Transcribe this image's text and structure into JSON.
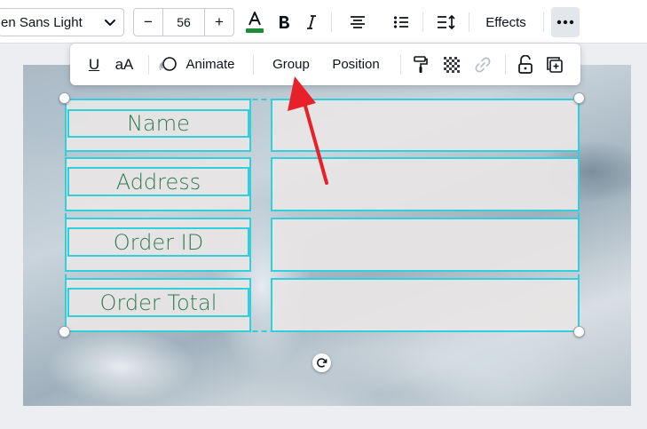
{
  "toolbar": {
    "font_name": "en Sans Light",
    "font_size": "56",
    "decrease_label": "−",
    "increase_label": "+",
    "effects_label": "Effects",
    "text_color": "#1f8a3a",
    "icons": [
      "chevron-down-icon",
      "text-color-icon",
      "bold-icon",
      "italic-icon",
      "align-center-icon",
      "list-icon",
      "spacing-icon",
      "more-icon"
    ]
  },
  "float_toolbar": {
    "underline_label": "U",
    "case_label": "aA",
    "animate_label": "Animate",
    "group_label": "Group",
    "position_label": "Position",
    "icons": [
      "animate-icon",
      "paint-roller-icon",
      "transparency-icon",
      "link-icon",
      "lock-icon",
      "duplicate-icon"
    ]
  },
  "table": {
    "labels": [
      "Name",
      "Address",
      "Order ID",
      "Order Total"
    ],
    "label_color": "#2f7a52",
    "border_color": "#2fd0dc"
  },
  "annotation": {
    "arrow_color": "#e8202a"
  }
}
